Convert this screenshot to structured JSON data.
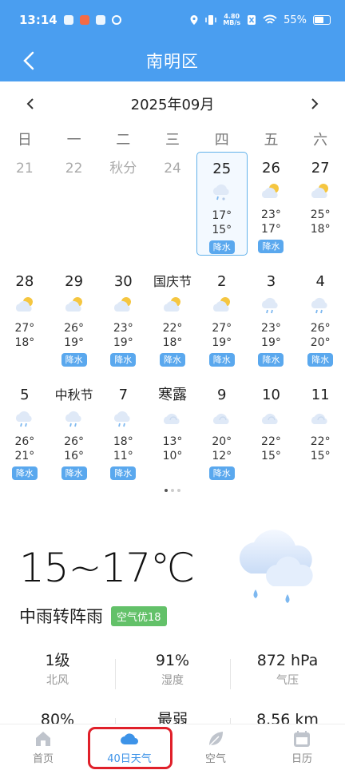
{
  "status_bar": {
    "time": "13:14",
    "speed_top": "4.80",
    "speed_bottom": "MB/s",
    "battery": "55%"
  },
  "nav": {
    "title": "南明区"
  },
  "calendar": {
    "month": "2025年09月",
    "weekdays": [
      "日",
      "一",
      "二",
      "三",
      "四",
      "五",
      "六"
    ],
    "rain_label": "降水",
    "weeks": [
      [
        {
          "label": "21",
          "muted": true
        },
        {
          "label": "22",
          "muted": true
        },
        {
          "label": "秋分",
          "muted": true
        },
        {
          "label": "24",
          "muted": true
        },
        {
          "label": "25",
          "selected": true,
          "icon": "rain-snow",
          "high": "17°",
          "low": "15°",
          "rain": true
        },
        {
          "label": "26",
          "icon": "partly-cloudy",
          "high": "23°",
          "low": "17°",
          "rain": true
        },
        {
          "label": "27",
          "icon": "partly-cloudy",
          "high": "25°",
          "low": "18°"
        }
      ],
      [
        {
          "label": "28",
          "icon": "partly-cloudy",
          "high": "27°",
          "low": "18°"
        },
        {
          "label": "29",
          "icon": "partly-cloudy",
          "high": "26°",
          "low": "19°",
          "rain": true
        },
        {
          "label": "30",
          "icon": "partly-cloudy",
          "high": "23°",
          "low": "19°",
          "rain": true
        },
        {
          "label": "国庆节",
          "icon": "partly-cloudy",
          "high": "22°",
          "low": "18°",
          "rain": true
        },
        {
          "label": "2",
          "icon": "partly-cloudy",
          "high": "27°",
          "low": "19°",
          "rain": true
        },
        {
          "label": "3",
          "icon": "rain",
          "high": "23°",
          "low": "19°",
          "rain": true
        },
        {
          "label": "4",
          "icon": "rain",
          "high": "26°",
          "low": "20°",
          "rain": true
        }
      ],
      [
        {
          "label": "5",
          "icon": "rain",
          "high": "26°",
          "low": "21°",
          "rain": true
        },
        {
          "label": "中秋节",
          "icon": "rain",
          "high": "26°",
          "low": "16°",
          "rain": true
        },
        {
          "label": "7",
          "icon": "rain",
          "high": "18°",
          "low": "11°",
          "rain": true
        },
        {
          "label": "寒露",
          "icon": "cloudy",
          "high": "13°",
          "low": "10°"
        },
        {
          "label": "9",
          "icon": "cloudy",
          "high": "20°",
          "low": "12°",
          "rain": true
        },
        {
          "label": "10",
          "icon": "cloudy",
          "high": "22°",
          "low": "15°"
        },
        {
          "label": "11",
          "icon": "cloudy",
          "high": "22°",
          "low": "15°"
        }
      ]
    ]
  },
  "today": {
    "temp_range": "15~17℃",
    "condition": "中雨转阵雨",
    "aqi": "空气优18",
    "icon": "moderate-rain-icon"
  },
  "stats": [
    {
      "value": "1级",
      "label": "北风"
    },
    {
      "value": "91%",
      "label": "湿度"
    },
    {
      "value": "872 hPa",
      "label": "气压"
    },
    {
      "value": "80%",
      "label": ""
    },
    {
      "value": "最弱",
      "label": ""
    },
    {
      "value": "8.56 km",
      "label": ""
    }
  ],
  "tabs": [
    {
      "label": "首页",
      "icon": "home-icon"
    },
    {
      "label": "40日天气",
      "icon": "cloud-icon",
      "active": true
    },
    {
      "label": "空气",
      "icon": "leaf-icon"
    },
    {
      "label": "日历",
      "icon": "calendar-icon"
    }
  ],
  "colors": {
    "primary": "#4a9ef0",
    "rain_badge": "#5aa8ee",
    "aqi": "#63c169",
    "highlight": "#e0202a"
  }
}
